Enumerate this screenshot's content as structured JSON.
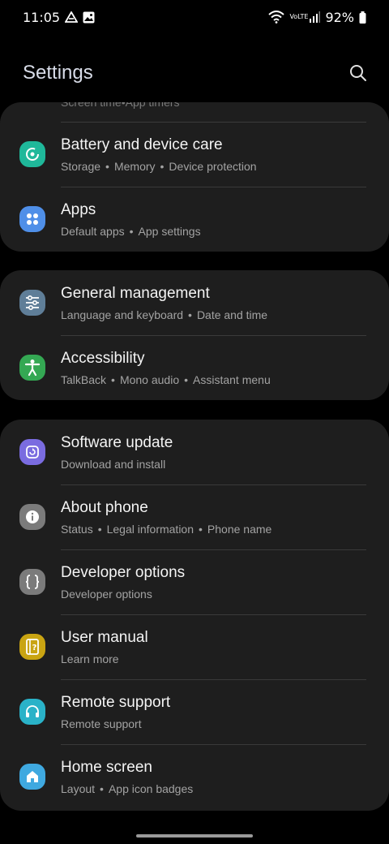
{
  "status": {
    "time": "11:05",
    "battery": "92%",
    "network": "VoLTE"
  },
  "header": {
    "title": "Settings"
  },
  "cut_item": {
    "subtitle": [
      "Screen time",
      "App timers"
    ]
  },
  "groups": [
    {
      "items": [
        {
          "label": "Battery and device care",
          "subs": [
            "Storage",
            "Memory",
            "Device protection"
          ],
          "icon": "battery-care-icon",
          "color": "#1fb89a"
        },
        {
          "label": "Apps",
          "subs": [
            "Default apps",
            "App settings"
          ],
          "icon": "apps-icon",
          "color": "#4f8fe8"
        }
      ]
    },
    {
      "items": [
        {
          "label": "General management",
          "subs": [
            "Language and keyboard",
            "Date and time"
          ],
          "icon": "sliders-icon",
          "color": "#5f7e98"
        },
        {
          "label": "Accessibility",
          "subs": [
            "TalkBack",
            "Mono audio",
            "Assistant menu"
          ],
          "icon": "accessibility-icon",
          "color": "#34a853"
        }
      ]
    },
    {
      "items": [
        {
          "label": "Software update",
          "subs": [
            "Download and install"
          ],
          "icon": "software-update-icon",
          "color": "#7a6ce0"
        },
        {
          "label": "About phone",
          "subs": [
            "Status",
            "Legal information",
            "Phone name"
          ],
          "icon": "info-icon",
          "color": "#7b7b7b"
        },
        {
          "label": "Developer options",
          "subs": [
            "Developer options"
          ],
          "icon": "code-braces-icon",
          "color": "#7b7b7b"
        },
        {
          "label": "User manual",
          "subs": [
            "Learn more"
          ],
          "icon": "manual-icon",
          "color": "#c9a412"
        },
        {
          "label": "Remote support",
          "subs": [
            "Remote support"
          ],
          "icon": "headset-icon",
          "color": "#2ab2c8"
        },
        {
          "label": "Home screen",
          "subs": [
            "Layout",
            "App icon badges"
          ],
          "icon": "home-icon",
          "color": "#3fa9e0"
        }
      ]
    }
  ]
}
